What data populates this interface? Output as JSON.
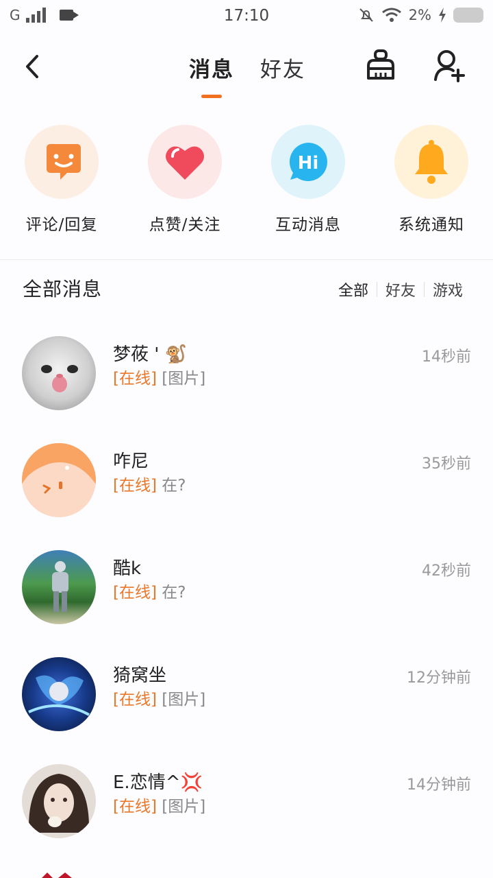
{
  "status": {
    "network": "G",
    "time": "17:10",
    "battery": "2%"
  },
  "header": {
    "tabs": [
      {
        "label": "消息"
      },
      {
        "label": "好友"
      }
    ]
  },
  "categories": [
    {
      "label": "评论/回复",
      "icon": "smile-chat-icon",
      "bg": "#fdeee3",
      "color": "#f5893b"
    },
    {
      "label": "点赞/关注",
      "icon": "heart-icon",
      "bg": "#fde8e8",
      "color": "#f04b5c"
    },
    {
      "label": "互动消息",
      "icon": "hi-bubble-icon",
      "bg": "#dff3fb",
      "color": "#27b4ef"
    },
    {
      "label": "系统通知",
      "icon": "bell-icon",
      "bg": "#fff2d9",
      "color": "#ffa91e"
    }
  ],
  "section": {
    "title": "全部消息",
    "filters": [
      {
        "label": "全部"
      },
      {
        "label": "好友"
      },
      {
        "label": "游戏"
      }
    ]
  },
  "messages": [
    {
      "name": "梦莜 ' 🐒",
      "status": "[在线]",
      "text": "[图片]",
      "time": "14秒前"
    },
    {
      "name": "咋尼",
      "status": "[在线]",
      "text": "在?",
      "time": "35秒前"
    },
    {
      "name": "酷k",
      "status": "[在线]",
      "text": "在?",
      "time": "42秒前"
    },
    {
      "name": "猗窝坐",
      "status": "[在线]",
      "text": "[图片]",
      "time": "12分钟前"
    },
    {
      "name": "E.恋情^💢",
      "status": "[在线]",
      "text": "[图片]",
      "time": "14分钟前"
    }
  ],
  "colors": {
    "accent": "#f07020",
    "online": "#e9782b"
  }
}
